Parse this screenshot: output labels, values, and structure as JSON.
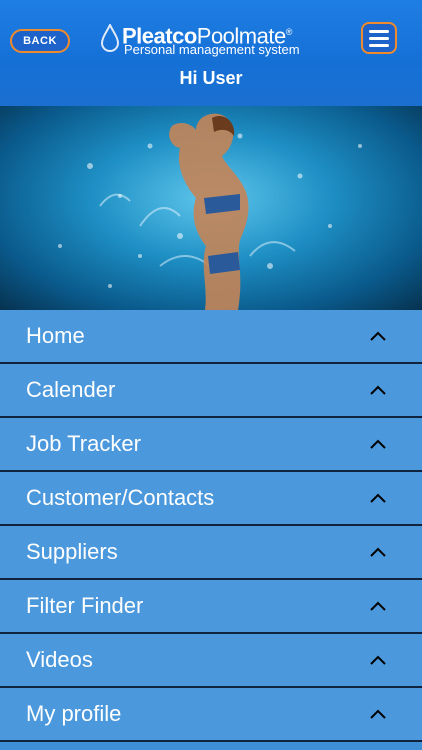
{
  "header": {
    "back_label": "BACK",
    "brand_bold": "Pleatco",
    "brand_regular": "Poolmate",
    "brand_mark": "®",
    "tagline": "Personal management system",
    "greeting": "Hi User"
  },
  "menu": {
    "items": [
      {
        "label": "Home"
      },
      {
        "label": "Calender"
      },
      {
        "label": "Job Tracker"
      },
      {
        "label": "Customer/Contacts"
      },
      {
        "label": "Suppliers"
      },
      {
        "label": "Filter Finder"
      },
      {
        "label": "Videos"
      },
      {
        "label": "My profile"
      }
    ]
  },
  "colors": {
    "header": "#1b74d8",
    "menu_item": "#4b98dc",
    "divider": "#10233f",
    "button_border": "#f08a2c"
  }
}
